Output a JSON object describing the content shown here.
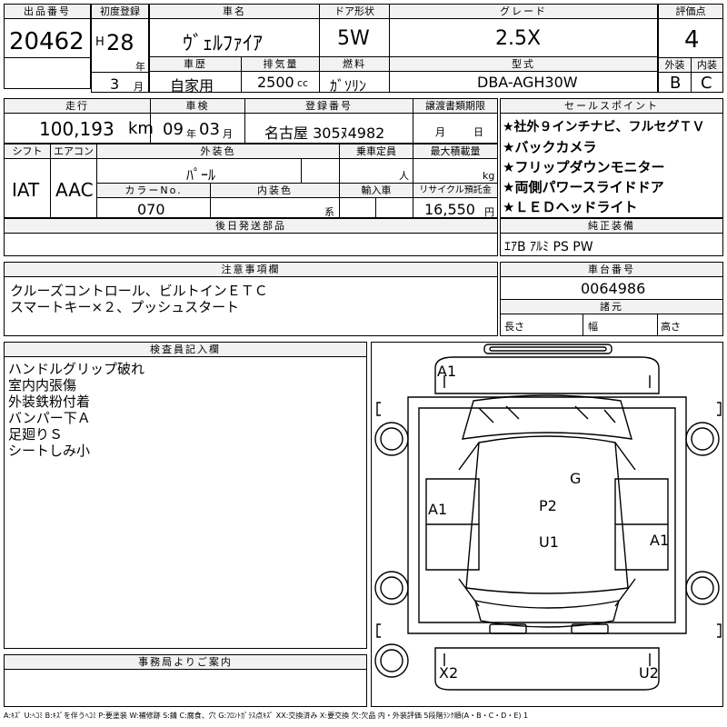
{
  "lot": {
    "label": "出品番号",
    "value": "20462"
  },
  "first_reg": {
    "label": "初度登録",
    "era": "H",
    "year": "28",
    "year_unit": "年",
    "month": "3",
    "month_unit": "月"
  },
  "car_name": {
    "label": "車名",
    "value": "ｳﾞｪﾙﾌｧｲｱ"
  },
  "door": {
    "label": "ドア形状",
    "value": "5W"
  },
  "grade": {
    "label": "グレード",
    "value": "2.5X"
  },
  "score": {
    "label": "評価点",
    "value": "4"
  },
  "history": {
    "label": "車歴",
    "value": "自家用"
  },
  "displacement": {
    "label": "排気量",
    "value": "2500",
    "unit": "cc"
  },
  "fuel": {
    "label": "燃料",
    "value": "ｶﾞｿﾘﾝ"
  },
  "model": {
    "label": "型式",
    "value": "DBA-AGH30W"
  },
  "ext_grade": {
    "label": "外装",
    "value": "B"
  },
  "int_grade": {
    "label": "内装",
    "value": "C"
  },
  "mileage": {
    "label": "走行",
    "value": "100,193",
    "unit": "km"
  },
  "inspection": {
    "label": "車検",
    "year": "09",
    "year_unit": "年",
    "month": "03",
    "month_unit": "月"
  },
  "plate": {
    "label": "登録番号",
    "value": "名古屋 305ﾇ4982"
  },
  "transfer": {
    "label": "譲渡書類期限",
    "month_unit": "月",
    "day_unit": "日"
  },
  "sales_points": {
    "label": "セールスポイント",
    "items": [
      "★社外９インチナビ、フルセグＴＶ",
      "★バックカメラ",
      "★フリップダウンモニター",
      "★両側パワースライドドア",
      "★ＬＥＤヘッドライト"
    ]
  },
  "shift": {
    "label": "シフト",
    "value": "IAT"
  },
  "aircon": {
    "label": "エアコン",
    "value": "AAC"
  },
  "ext_color": {
    "label": "外装色",
    "value": "ﾊﾟｰﾙ"
  },
  "capacity": {
    "label": "乗車定員",
    "unit": "人"
  },
  "max_load": {
    "label": "最大積載量",
    "unit": "kg"
  },
  "color_no": {
    "label": "カラーNo.",
    "value": "070"
  },
  "int_color": {
    "label": "内装色",
    "unit": "系"
  },
  "import": {
    "label": "輸入車"
  },
  "recycle": {
    "label": "リサイクル預託金",
    "value": "16,550",
    "unit": "円"
  },
  "parts": {
    "label": "後日発送部品"
  },
  "equipment": {
    "label": "純正装備",
    "value": "ｴｱB ｱﾙﾐ PS PW"
  },
  "notes": {
    "label": "注意事項欄",
    "lines": [
      "クルーズコントロール、ビルトインＥＴＣ",
      "スマートキー×２、プッシュスタート"
    ]
  },
  "chassis": {
    "label": "車台番号",
    "value": "0064986"
  },
  "dims": {
    "label": "諸元",
    "length": "長さ",
    "width": "幅",
    "height": "高さ"
  },
  "inspector": {
    "label": "検査員記入欄",
    "lines": [
      "ハンドルグリップ破れ",
      "室内内張傷",
      "外装鉄粉付着",
      "バンパー下Ａ",
      "足廻りＳ",
      "シートしみ小"
    ]
  },
  "office": {
    "label": "事務局よりご案内"
  },
  "diagram_marks": {
    "front": "A1",
    "left": "A1",
    "roof_g": "G",
    "roof_p": "P2",
    "roof_u": "U1",
    "right": "A1",
    "rear_left": "X2",
    "rear_right": "U2"
  },
  "legend": "A:ｷｽﾞ U:ﾍｺﾐ B:ｷｽﾞを伴うﾍｺﾐ P:要塗装 W:補修跡 S:錆 C:腐食、穴 G:ﾌﾛﾝﾄｶﾞﾗｽ点ｷｽﾞ XX:交換済み X:要交換 欠:欠品 内・外装評価 5段階ﾗﾝｸ順(A・B・C・D・E) 1"
}
